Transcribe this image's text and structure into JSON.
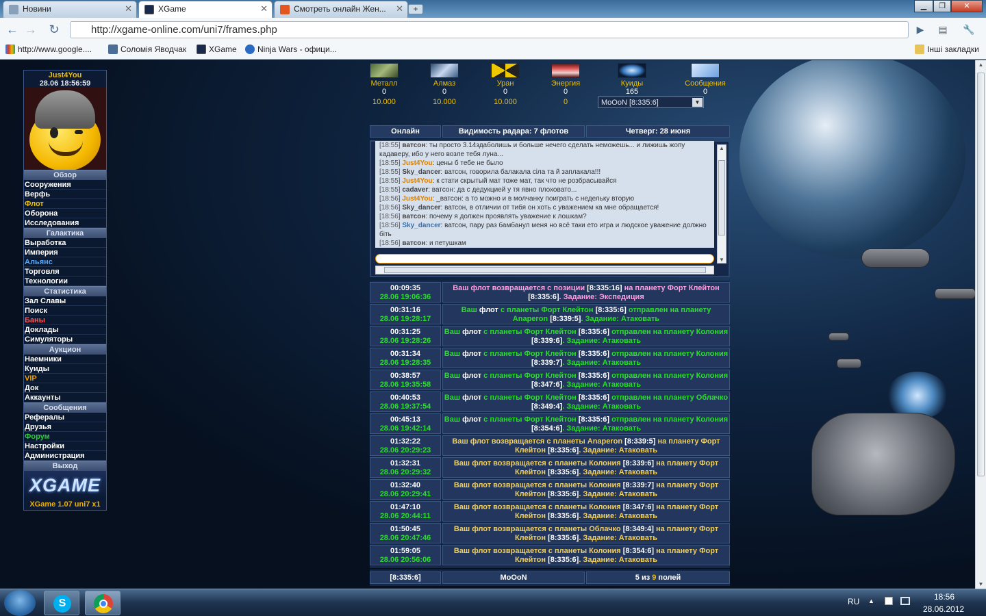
{
  "browser": {
    "tabs": [
      {
        "label": "Новини",
        "icon": "news-icon",
        "color": "#8aa0b8"
      },
      {
        "label": "XGame",
        "icon": "xgame-icon",
        "color": "#1a2a4a"
      },
      {
        "label": "Смотреть онлайн Жен...",
        "icon": "video-icon",
        "color": "#e2571f"
      }
    ],
    "new_tab_label": "+",
    "url": "http://xgame-online.com/uni7/frames.php",
    "bookmarks": [
      {
        "label": "http://www.google....",
        "icon": "google-icon"
      },
      {
        "label": "Соломія Яводчак",
        "icon": "vk-icon"
      },
      {
        "label": "XGame",
        "icon": "xgame-icon"
      },
      {
        "label": "Ninja Wars - офици...",
        "icon": "ninja-icon"
      }
    ],
    "other_bookmarks": "Інші закладки"
  },
  "menu": {
    "username": "Just4You",
    "datetime": "28.06 18:56:59",
    "sections": [
      {
        "title": "Обзор",
        "items": [
          {
            "label": "Сооружения",
            "color": "#ffffff"
          },
          {
            "label": "Верфь",
            "color": "#ffffff"
          },
          {
            "label": "Флот",
            "color": "#f0c000"
          },
          {
            "label": "Оборона",
            "color": "#ffffff"
          },
          {
            "label": "Исследования",
            "color": "#ffffff"
          }
        ]
      },
      {
        "title": "Галактика",
        "items": [
          {
            "label": "Выработка",
            "color": "#ffffff"
          },
          {
            "label": "Империя",
            "color": "#ffffff"
          },
          {
            "label": "Альянс",
            "color": "#4fa8ff"
          },
          {
            "label": "Торговля",
            "color": "#ffffff"
          },
          {
            "label": "Технологии",
            "color": "#ffffff"
          }
        ]
      },
      {
        "title": "Статистика",
        "items": [
          {
            "label": "Зал Славы",
            "color": "#ffffff"
          },
          {
            "label": "Поиск",
            "color": "#ffffff"
          },
          {
            "label": "Баны",
            "color": "#ff5555"
          },
          {
            "label": "Доклады",
            "color": "#ffffff"
          },
          {
            "label": "Симуляторы",
            "color": "#ffffff"
          }
        ]
      },
      {
        "title": "Аукцион",
        "items": [
          {
            "label": "Наемники",
            "color": "#ffffff"
          },
          {
            "label": "Куиды",
            "color": "#ffffff"
          },
          {
            "label": "VIP",
            "color": "#f0a000"
          },
          {
            "label": "Док",
            "color": "#ffffff"
          },
          {
            "label": "Аккаунты",
            "color": "#ffffff"
          }
        ]
      },
      {
        "title": "Сообщения",
        "items": [
          {
            "label": "Рефералы",
            "color": "#ffffff"
          },
          {
            "label": "Друзья",
            "color": "#ffffff"
          },
          {
            "label": "Форум",
            "color": "#2ecc40"
          },
          {
            "label": "Настройки",
            "color": "#ffffff"
          },
          {
            "label": "Администрация",
            "color": "#ffffff"
          }
        ]
      }
    ],
    "logout": "Выход",
    "logo_text": "XGAME",
    "version": "XGame 1.07 uni7 x1"
  },
  "resources": [
    {
      "name": "Металл",
      "value": "0",
      "cap": "10.000",
      "icon": "metal-icon"
    },
    {
      "name": "Алмаз",
      "value": "0",
      "cap": "10.000",
      "icon": "diamond-icon"
    },
    {
      "name": "Уран",
      "value": "0",
      "cap": "10.000",
      "icon": "uranium-icon"
    },
    {
      "name": "Энергия",
      "value": "0",
      "cap": "0",
      "icon": "energy-icon"
    },
    {
      "name": "Куиды",
      "value": "165",
      "cap": "",
      "icon": "quid-icon"
    },
    {
      "name": "Сообщения",
      "value": "0",
      "cap": "",
      "icon": "messages-icon"
    }
  ],
  "planet_select": "MoOoN [8:335:6]",
  "header": {
    "online": "Онлайн",
    "radar": "Видимость радара: 7 флотов",
    "date": "Четверг: 28 июня"
  },
  "chat": [
    {
      "time": "[18:55]",
      "name": "ватсон",
      "style": "nm",
      "text": ": ты просто 3.14здаболишь и больше нечего сделать неможешь... и лижишь жопу кадаверу, ибо у него возле тебя луна..."
    },
    {
      "time": "[18:55]",
      "name": "Just4You",
      "style": "me",
      "text": ": цены б тебе не было"
    },
    {
      "time": "[18:55]",
      "name": "Sky_dancer",
      "style": "nm",
      "text": ": ватсон, говорила балакала сіла та й заплакала!!!"
    },
    {
      "time": "[18:55]",
      "name": "Just4You",
      "style": "me",
      "text": ": к стати скрытый мат тоже мат, так что не розбрасывайся"
    },
    {
      "time": "[18:55]",
      "name": "cadaver",
      "style": "nm",
      "text": ": ватсон: да с дедукцией у тя явно плоховато..."
    },
    {
      "time": "[18:56]",
      "name": "Just4You",
      "style": "me",
      "text": ": _ватсон: а то можно и в молчанку поиграть с недельку вторую"
    },
    {
      "time": "[18:56]",
      "name": "Sky_dancer",
      "style": "nm",
      "text": ": ватсон, в отличии от тибя он хоть с уважением ка мне обращается!"
    },
    {
      "time": "[18:56]",
      "name": "ватсон",
      "style": "nm",
      "text": ": почему я должен проявлять уважение к лошкам?"
    },
    {
      "time": "[18:56]",
      "name": "Sky_dancer",
      "style": "sky",
      "text": ": ватсон, пару раз бамбанул меня но всё таки ето игра и людское уважение должно біть"
    },
    {
      "time": "[18:56]",
      "name": "ватсон",
      "style": "nm",
      "text": ": и петушкам"
    }
  ],
  "fleets": [
    {
      "countdown": "00:09:35",
      "arrival": "28.06 19:06:36",
      "segments": [
        {
          "t": "Ваш флот возвращается с позиции ",
          "c": "#ff9ee0"
        },
        {
          "t": "[8:335:16]",
          "c": "#ffffff"
        },
        {
          "t": " на планету Форт Клейтон ",
          "c": "#ff9ee0"
        },
        {
          "t": "[8:335:6]",
          "c": "#ffffff"
        },
        {
          "t": ". Задание: Экспедиция",
          "c": "#ff9ee0"
        }
      ]
    },
    {
      "countdown": "00:31:16",
      "arrival": "28.06 19:28:17",
      "segments": [
        {
          "t": "Ваш ",
          "c": "#2ddd2d"
        },
        {
          "t": "флот",
          "c": "#ffffff"
        },
        {
          "t": " с планеты Форт Клейтон ",
          "c": "#2ddd2d"
        },
        {
          "t": "[8:335:6]",
          "c": "#ffffff"
        },
        {
          "t": " отправлен на планету Anaperon ",
          "c": "#2ddd2d"
        },
        {
          "t": "[8:339:5]",
          "c": "#ffffff"
        },
        {
          "t": ". Задание: Атаковать",
          "c": "#2ddd2d"
        }
      ]
    },
    {
      "countdown": "00:31:25",
      "arrival": "28.06 19:28:26",
      "segments": [
        {
          "t": "Ваш ",
          "c": "#2ddd2d"
        },
        {
          "t": "флот",
          "c": "#ffffff"
        },
        {
          "t": " с планеты Форт Клейтон ",
          "c": "#2ddd2d"
        },
        {
          "t": "[8:335:6]",
          "c": "#ffffff"
        },
        {
          "t": " отправлен на планету Колония ",
          "c": "#2ddd2d"
        },
        {
          "t": "[8:339:6]",
          "c": "#ffffff"
        },
        {
          "t": ". Задание: Атаковать",
          "c": "#2ddd2d"
        }
      ]
    },
    {
      "countdown": "00:31:34",
      "arrival": "28.06 19:28:35",
      "segments": [
        {
          "t": "Ваш ",
          "c": "#2ddd2d"
        },
        {
          "t": "флот",
          "c": "#ffffff"
        },
        {
          "t": " с планеты Форт Клейтон ",
          "c": "#2ddd2d"
        },
        {
          "t": "[8:335:6]",
          "c": "#ffffff"
        },
        {
          "t": " отправлен на планету Колония ",
          "c": "#2ddd2d"
        },
        {
          "t": "[8:339:7]",
          "c": "#ffffff"
        },
        {
          "t": ". Задание: Атаковать",
          "c": "#2ddd2d"
        }
      ]
    },
    {
      "countdown": "00:38:57",
      "arrival": "28.06 19:35:58",
      "segments": [
        {
          "t": "Ваш ",
          "c": "#2ddd2d"
        },
        {
          "t": "флот",
          "c": "#ffffff"
        },
        {
          "t": " с планеты Форт Клейтон ",
          "c": "#2ddd2d"
        },
        {
          "t": "[8:335:6]",
          "c": "#ffffff"
        },
        {
          "t": " отправлен на планету Колония ",
          "c": "#2ddd2d"
        },
        {
          "t": "[8:347:6]",
          "c": "#ffffff"
        },
        {
          "t": ". Задание: Атаковать",
          "c": "#2ddd2d"
        }
      ]
    },
    {
      "countdown": "00:40:53",
      "arrival": "28.06 19:37:54",
      "segments": [
        {
          "t": "Ваш ",
          "c": "#2ddd2d"
        },
        {
          "t": "флот",
          "c": "#ffffff"
        },
        {
          "t": " с планеты Форт Клейтон ",
          "c": "#2ddd2d"
        },
        {
          "t": "[8:335:6]",
          "c": "#ffffff"
        },
        {
          "t": " отправлен на планету Облачко ",
          "c": "#2ddd2d"
        },
        {
          "t": "[8:349:4]",
          "c": "#ffffff"
        },
        {
          "t": ". Задание: Атаковать",
          "c": "#2ddd2d"
        }
      ]
    },
    {
      "countdown": "00:45:13",
      "arrival": "28.06 19:42:14",
      "segments": [
        {
          "t": "Ваш ",
          "c": "#2ddd2d"
        },
        {
          "t": "флот",
          "c": "#ffffff"
        },
        {
          "t": " с планеты Форт Клейтон ",
          "c": "#2ddd2d"
        },
        {
          "t": "[8:335:6]",
          "c": "#ffffff"
        },
        {
          "t": " отправлен на планету Колония ",
          "c": "#2ddd2d"
        },
        {
          "t": "[8:354:6]",
          "c": "#ffffff"
        },
        {
          "t": ". Задание: Атаковать",
          "c": "#2ddd2d"
        }
      ]
    },
    {
      "countdown": "01:32:22",
      "arrival": "28.06 20:29:23",
      "segments": [
        {
          "t": "Ваш флот возвращается с планеты Anaperon ",
          "c": "#f0d060"
        },
        {
          "t": "[8:339:5]",
          "c": "#ffffff"
        },
        {
          "t": " на планету Форт Клейтон ",
          "c": "#f0d060"
        },
        {
          "t": "[8:335:6]",
          "c": "#ffffff"
        },
        {
          "t": ". Задание: Атаковать",
          "c": "#f0d060"
        }
      ]
    },
    {
      "countdown": "01:32:31",
      "arrival": "28.06 20:29:32",
      "segments": [
        {
          "t": "Ваш флот возвращается с планеты Колония ",
          "c": "#f0d060"
        },
        {
          "t": "[8:339:6]",
          "c": "#ffffff"
        },
        {
          "t": " на планету Форт Клейтон ",
          "c": "#f0d060"
        },
        {
          "t": "[8:335:6]",
          "c": "#ffffff"
        },
        {
          "t": ". Задание: Атаковать",
          "c": "#f0d060"
        }
      ]
    },
    {
      "countdown": "01:32:40",
      "arrival": "28.06 20:29:41",
      "segments": [
        {
          "t": "Ваш флот возвращается с планеты Колония ",
          "c": "#f0d060"
        },
        {
          "t": "[8:339:7]",
          "c": "#ffffff"
        },
        {
          "t": " на планету Форт Клейтон ",
          "c": "#f0d060"
        },
        {
          "t": "[8:335:6]",
          "c": "#ffffff"
        },
        {
          "t": ". Задание: Атаковать",
          "c": "#f0d060"
        }
      ]
    },
    {
      "countdown": "01:47:10",
      "arrival": "28.06 20:44:11",
      "segments": [
        {
          "t": "Ваш флот возвращается с планеты Колония ",
          "c": "#f0d060"
        },
        {
          "t": "[8:347:6]",
          "c": "#ffffff"
        },
        {
          "t": " на планету Форт Клейтон ",
          "c": "#f0d060"
        },
        {
          "t": "[8:335:6]",
          "c": "#ffffff"
        },
        {
          "t": ". Задание: Атаковать",
          "c": "#f0d060"
        }
      ]
    },
    {
      "countdown": "01:50:45",
      "arrival": "28.06 20:47:46",
      "segments": [
        {
          "t": "Ваш флот возвращается с планеты Облачко ",
          "c": "#f0d060"
        },
        {
          "t": "[8:349:4]",
          "c": "#ffffff"
        },
        {
          "t": " на планету Форт Клейтон ",
          "c": "#f0d060"
        },
        {
          "t": "[8:335:6]",
          "c": "#ffffff"
        },
        {
          "t": ". Задание: Атаковать",
          "c": "#f0d060"
        }
      ]
    },
    {
      "countdown": "01:59:05",
      "arrival": "28.06 20:56:06",
      "segments": [
        {
          "t": "Ваш флот возвращается с планеты Колония ",
          "c": "#f0d060"
        },
        {
          "t": "[8:354:6]",
          "c": "#ffffff"
        },
        {
          "t": " на планету Форт Клейтон ",
          "c": "#f0d060"
        },
        {
          "t": "[8:335:6]",
          "c": "#ffffff"
        },
        {
          "t": ". Задание: Атаковать",
          "c": "#f0d060"
        }
      ]
    }
  ],
  "footer": {
    "coords": "[8:335:6]",
    "planet_name": "MoOoN",
    "fields_used": "5",
    "fields_of": "из",
    "fields_total": "9",
    "fields_label": "полей"
  },
  "taskbar": {
    "lang": "RU",
    "time": "18:56",
    "date": "28.06.2012"
  }
}
